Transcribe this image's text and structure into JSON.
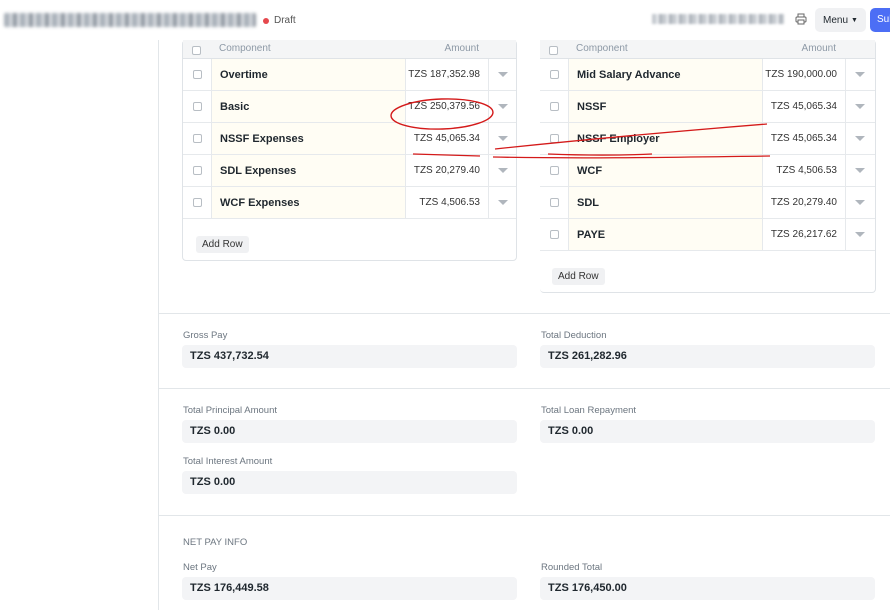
{
  "header": {
    "status": "Draft",
    "menu_label": "Menu",
    "submit_label": "Submit"
  },
  "earnings": {
    "col_component": "Component",
    "col_amount": "Amount",
    "rows": [
      {
        "component": "Overtime",
        "amount": "TZS 187,352.98"
      },
      {
        "component": "Basic",
        "amount": "TZS 250,379.56"
      },
      {
        "component": "NSSF Expenses",
        "amount": "TZS 45,065.34"
      },
      {
        "component": "SDL Expenses",
        "amount": "TZS 20,279.40"
      },
      {
        "component": "WCF Expenses",
        "amount": "TZS 4,506.53"
      }
    ],
    "add_row": "Add Row"
  },
  "deductions": {
    "col_component": "Component",
    "col_amount": "Amount",
    "rows": [
      {
        "component": "Mid Salary Advance",
        "amount": "TZS 190,000.00"
      },
      {
        "component": "NSSF",
        "amount": "TZS 45,065.34"
      },
      {
        "component": "NSSF Employer",
        "amount": "TZS 45,065.34"
      },
      {
        "component": "WCF",
        "amount": "TZS 4,506.53"
      },
      {
        "component": "SDL",
        "amount": "TZS 20,279.40"
      },
      {
        "component": "PAYE",
        "amount": "TZS 26,217.62"
      }
    ],
    "add_row": "Add Row"
  },
  "totals": {
    "gross_pay_label": "Gross Pay",
    "gross_pay": "TZS 437,732.54",
    "total_deduction_label": "Total Deduction",
    "total_deduction": "TZS 261,282.96"
  },
  "loan": {
    "principal_label": "Total Principal Amount",
    "principal": "TZS 0.00",
    "repayment_label": "Total Loan Repayment",
    "repayment": "TZS 0.00",
    "interest_label": "Total Interest Amount",
    "interest": "TZS 0.00"
  },
  "net_pay": {
    "section_title": "NET PAY INFO",
    "net_pay_label": "Net Pay",
    "net_pay": "TZS 176,449.58",
    "rounded_label": "Rounded Total",
    "rounded": "TZS 176,450.00"
  },
  "icons": {
    "print": "printer-icon",
    "caret": "chevron-down-icon"
  },
  "colors": {
    "draft_dot": "#e5484d",
    "primary": "#4c6ef5",
    "annotation": "#d41a1a"
  }
}
